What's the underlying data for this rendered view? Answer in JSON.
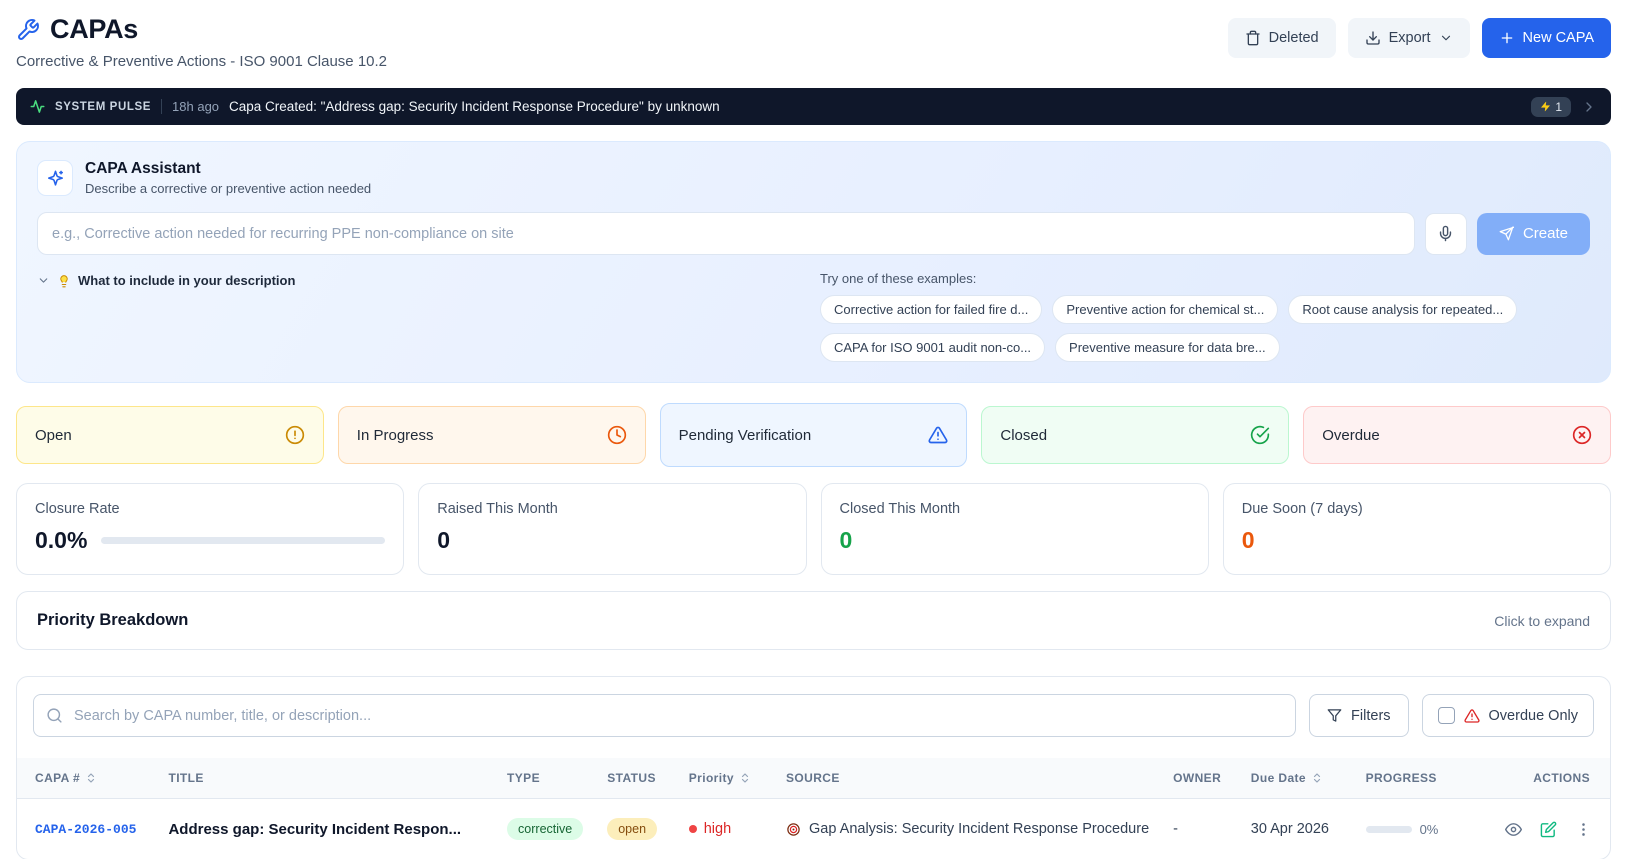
{
  "header": {
    "title": "CAPAs",
    "subtitle": "Corrective & Preventive Actions - ISO 9001 Clause 10.2",
    "buttons": {
      "deleted": "Deleted",
      "export": "Export",
      "new_capa": "New CAPA"
    }
  },
  "system_pulse": {
    "label": "SYSTEM PULSE",
    "time_ago": "18h ago",
    "message": "Capa Created: \"Address gap: Security Incident Response Procedure\" by unknown",
    "event_count": "1"
  },
  "assistant": {
    "title": "CAPA Assistant",
    "subtitle": "Describe a corrective or preventive action needed",
    "input_placeholder": "e.g., Corrective action needed for recurring PPE non-compliance on site",
    "create_button": "Create",
    "details_toggle": "What to include in your description",
    "examples_label": "Try one of these examples:",
    "examples": [
      "Corrective action for failed fire d...",
      "Preventive action for chemical st...",
      "Root cause analysis for repeated...",
      "CAPA for ISO 9001 audit non-co...",
      "Preventive measure for data bre..."
    ]
  },
  "status_cards": [
    {
      "label": "Open",
      "icon": "alert-circle-icon",
      "color": "#ca8a04"
    },
    {
      "label": "In Progress",
      "icon": "clock-icon",
      "color": "#ea580c"
    },
    {
      "label": "Pending Verification",
      "icon": "alert-triangle-icon",
      "color": "#2563eb"
    },
    {
      "label": "Closed",
      "icon": "check-circle-icon",
      "color": "#16a34a"
    },
    {
      "label": "Overdue",
      "icon": "x-circle-icon",
      "color": "#dc2626"
    }
  ],
  "stats": [
    {
      "label": "Closure Rate",
      "value": "0.0%"
    },
    {
      "label": "Raised This Month",
      "value": "0"
    },
    {
      "label": "Closed This Month",
      "value": "0",
      "color": "#16a34a"
    },
    {
      "label": "Due Soon (7 days)",
      "value": "0",
      "color": "#ea580c"
    }
  ],
  "priority_breakdown": {
    "title": "Priority Breakdown",
    "hint": "Click to expand"
  },
  "toolbar": {
    "search_placeholder": "Search by CAPA number, title, or description...",
    "filters_button": "Filters",
    "overdue_only_label": "Overdue Only"
  },
  "table": {
    "columns": [
      "CAPA #",
      "TITLE",
      "TYPE",
      "STATUS",
      "Priority",
      "SOURCE",
      "OWNER",
      "Due Date",
      "PROGRESS",
      "ACTIONS"
    ],
    "rows": [
      {
        "capa_number": "CAPA-2026-005",
        "title": "Address gap: Security Incident Respon...",
        "type": "corrective",
        "status": "open",
        "priority": "high",
        "source": "Gap Analysis: Security Incident Response Procedure",
        "owner": "-",
        "due_date": "30 Apr 2026",
        "progress": "0%"
      }
    ]
  },
  "colors": {
    "accent": "#2563eb",
    "pulse_bar_bg": "#0f172a",
    "type_corrective_bg": "#dcfce7",
    "type_corrective_text": "#166534",
    "status_open_bg": "#fceebb",
    "status_open_text": "#854d0e",
    "priority_high": "#dc2626"
  }
}
